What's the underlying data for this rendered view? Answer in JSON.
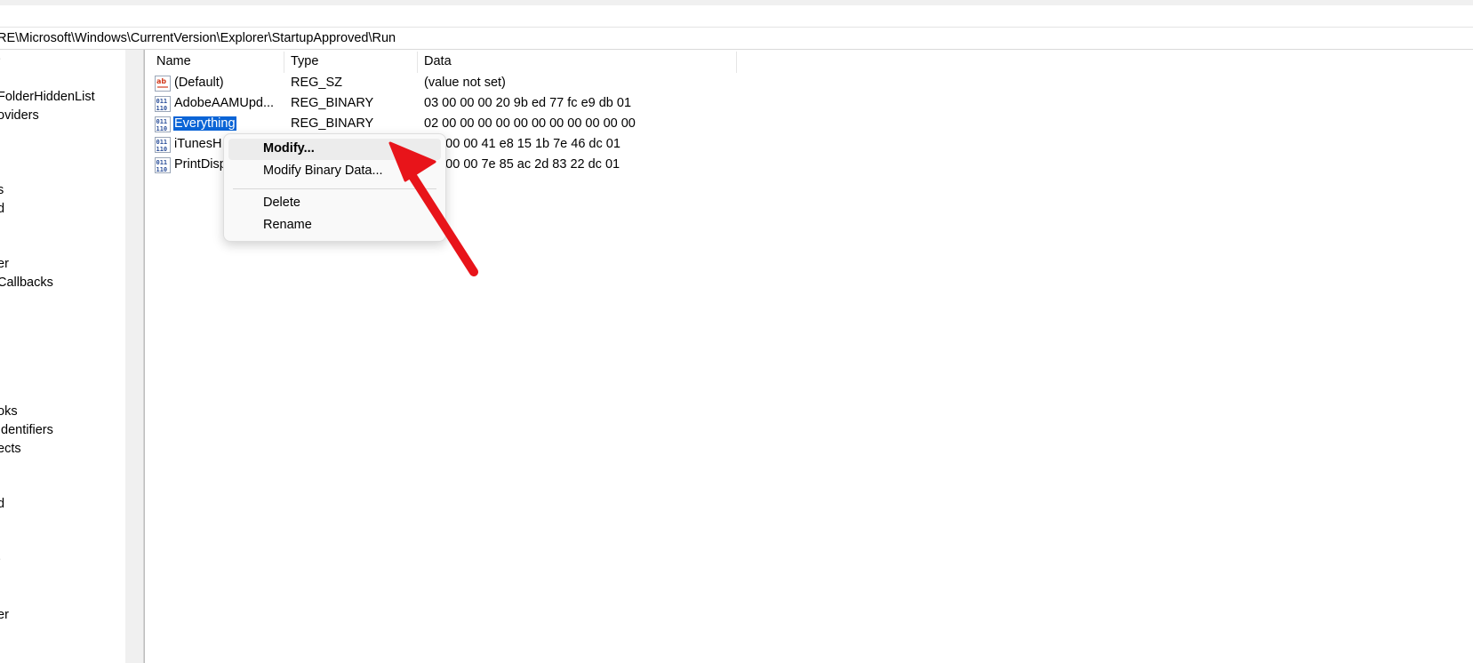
{
  "address_bar": {
    "path": "RE\\Microsoft\\Windows\\CurrentVersion\\Explorer\\StartupApproved\\Run"
  },
  "tree": {
    "items": [
      {
        "label": "FolderHiddenList"
      },
      {
        "label": "oviders"
      },
      {
        "label": "s"
      },
      {
        "label": "d"
      },
      {
        "label": "er"
      },
      {
        "label": "Callbacks"
      },
      {
        "label": "oks"
      },
      {
        "label": "Identifiers"
      },
      {
        "label": "ects"
      },
      {
        "label": "d"
      },
      {
        "label": "er"
      }
    ]
  },
  "list": {
    "columns": [
      {
        "label": "Name"
      },
      {
        "label": "Type"
      },
      {
        "label": "Data"
      }
    ],
    "rows": [
      {
        "name": "(Default)",
        "type": "REG_SZ",
        "data": "(value not set)",
        "icon": "string-value-icon"
      },
      {
        "name": "AdobeAAMUpd...",
        "type": "REG_BINARY",
        "data": "03 00 00 00 20 9b ed 77 fc e9 db 01",
        "icon": "binary-value-icon"
      },
      {
        "name": "Everything",
        "type": "REG_BINARY",
        "data": "02 00 00 00 00 00 00 00 00 00 00 00",
        "icon": "binary-value-icon"
      },
      {
        "name": "iTunesH",
        "type": "",
        "data": "00 00 00 41 e8 15 1b 7e 46 dc 01",
        "icon": "binary-value-icon"
      },
      {
        "name": "PrintDisp",
        "type": "",
        "data": "00 00 00 7e 85 ac 2d 83 22 dc 01",
        "icon": "binary-value-icon"
      }
    ]
  },
  "context_menu": {
    "modify": "Modify...",
    "modify_binary": "Modify Binary Data...",
    "delete": "Delete",
    "rename": "Rename"
  },
  "colors": {
    "selection": "#0a64d6",
    "annotation_arrow": "#e8141a"
  }
}
